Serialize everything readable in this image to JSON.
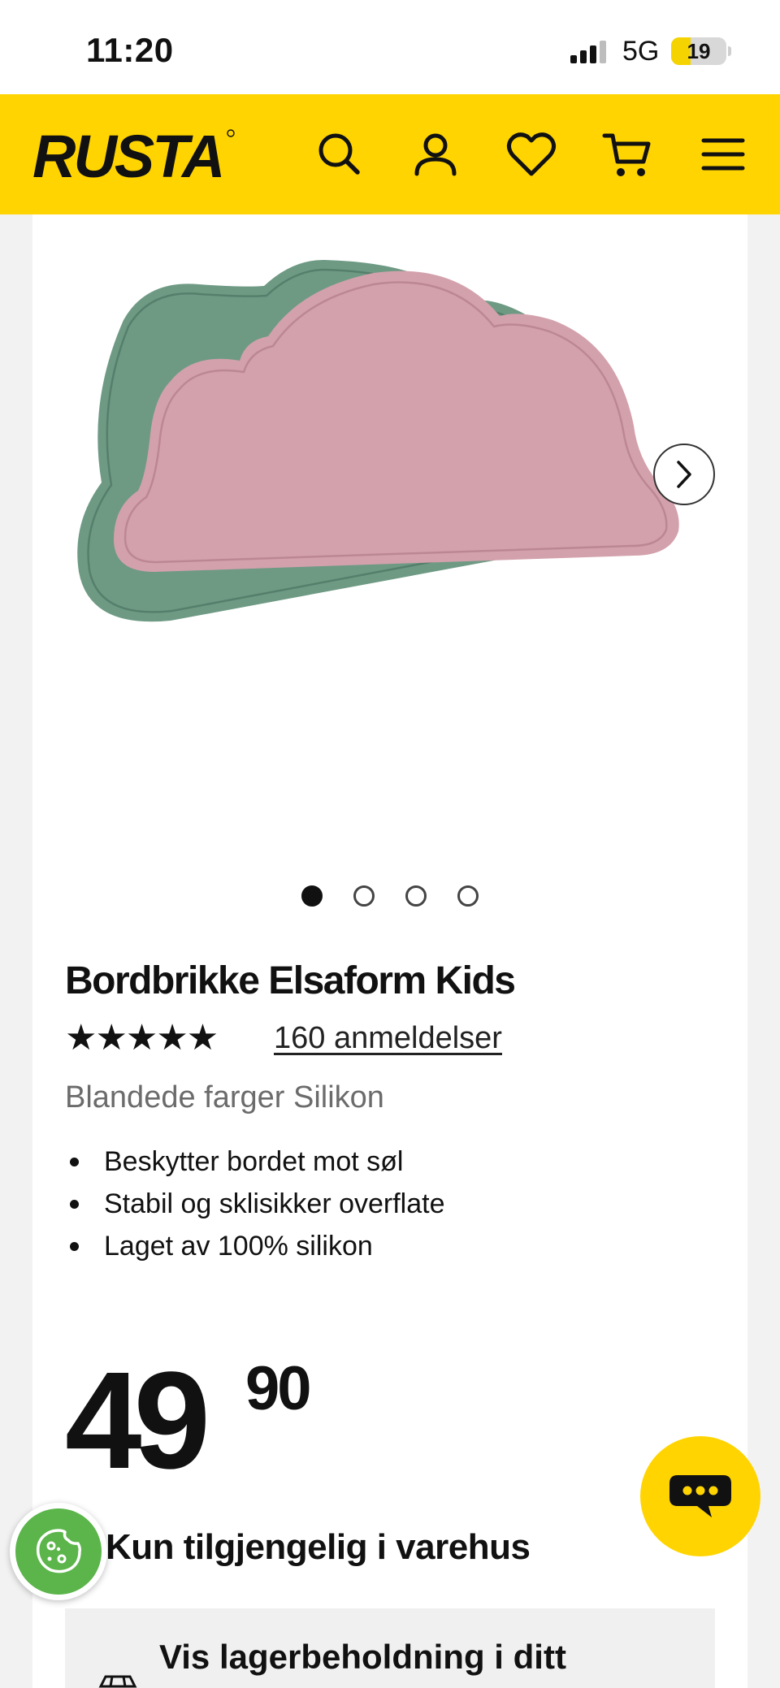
{
  "status_bar": {
    "time": "11:20",
    "network": "5G",
    "battery": "19"
  },
  "header": {
    "brand": "RUSTA",
    "icons": [
      "search-icon",
      "account-icon",
      "heart-icon",
      "cart-icon",
      "menu-icon"
    ]
  },
  "colors": {
    "brand_yellow": "#ffd400",
    "text": "#111111",
    "muted": "#6b6b6b",
    "cookie_green": "#5bb54a"
  },
  "gallery": {
    "total_images": 4,
    "active_index": 0
  },
  "product": {
    "title": "Bordbrikke Elsaform Kids",
    "stars": "★★★★★",
    "rating": 5,
    "reviews": "160 anmeldelser",
    "variant": "Blandede farger Silikon",
    "features": [
      "Beskytter bordet mot søl",
      "Stabil og sklisikker overflate",
      "Laget av 100% silikon"
    ],
    "price_int": "49",
    "price_dec": "90",
    "availability": "Kun tilgjengelig i varehus",
    "stock_link": "Vis lagerbeholdning i ditt"
  }
}
